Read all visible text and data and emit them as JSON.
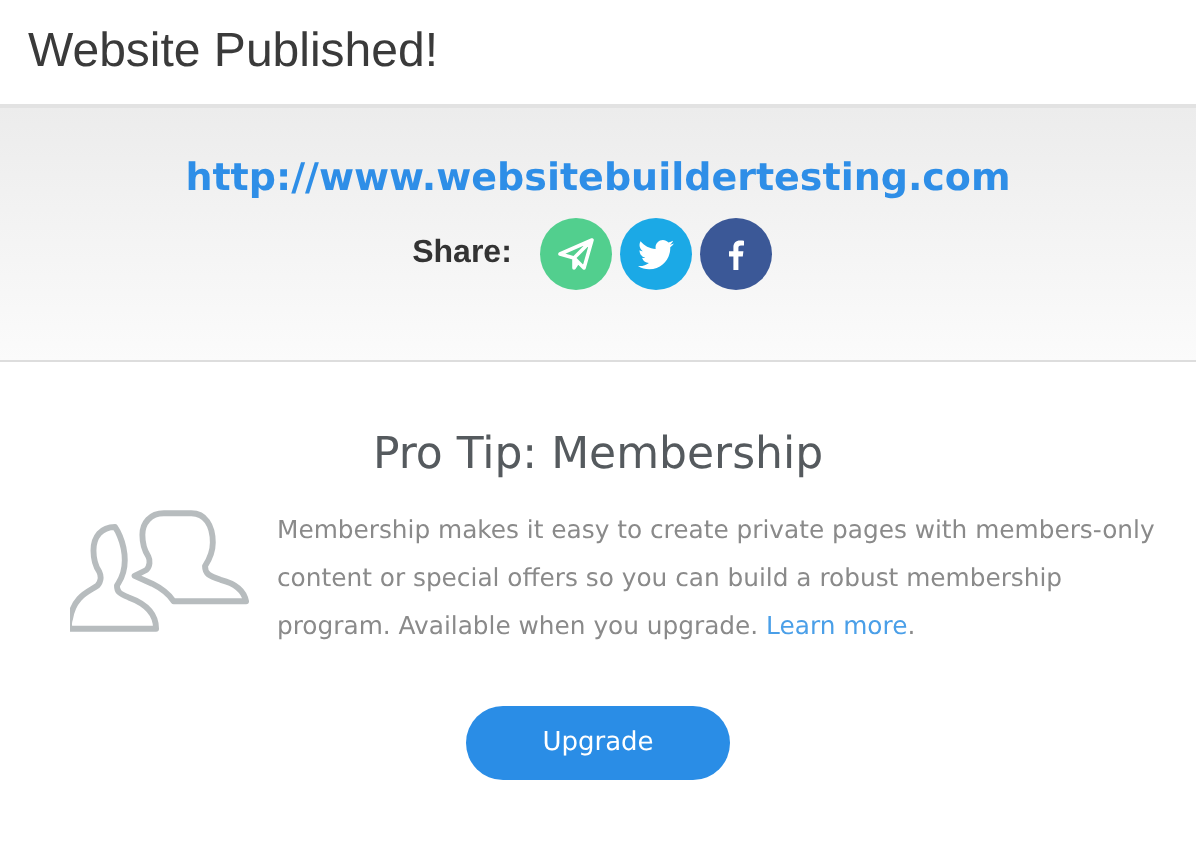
{
  "header": {
    "title": "Website Published!"
  },
  "publish": {
    "url": "http://www.websitebuildertesting.com",
    "share_label": "Share:",
    "share_buttons": [
      {
        "kind": "send",
        "color": "#52cf8e"
      },
      {
        "kind": "bird",
        "color": "#1ba9e6"
      },
      {
        "kind": "facebook",
        "color": "#3b5897"
      }
    ]
  },
  "tip": {
    "title": "Pro Tip: Membership",
    "text": "Membership makes it easy to create private pages with members-only content or special offers so you can build a robust membership program. Available when you upgrade. ",
    "link": "Learn more",
    "after": ".",
    "button": "Upgrade"
  }
}
